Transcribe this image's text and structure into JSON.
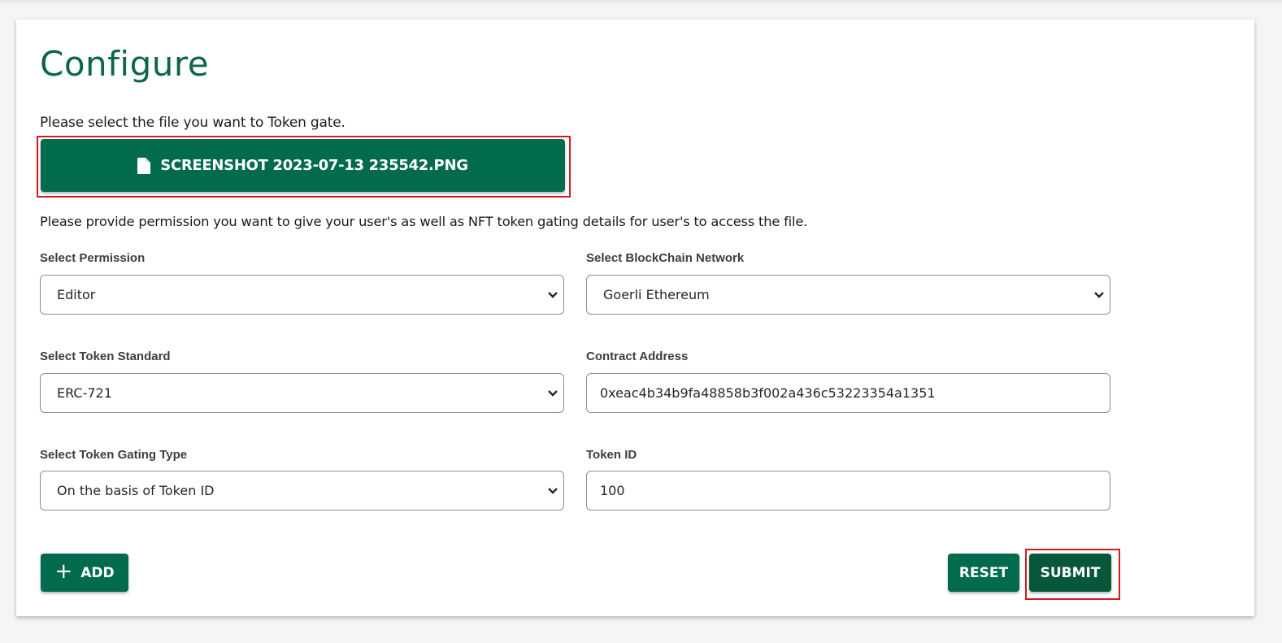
{
  "page": {
    "title": "Configure",
    "file_prompt": "Please select the file you want to Token gate.",
    "selected_file": {
      "label": "SCREENSHOT 2023-07-13 235542.PNG",
      "icon": "file-icon"
    },
    "permission_prompt": "Please provide permission you want to give your user's as well as NFT token gating details for user's to access the file."
  },
  "form": {
    "permission": {
      "label": "Select Permission",
      "value": "Editor"
    },
    "network": {
      "label": "Select BlockChain Network",
      "value": "Goerli Ethereum"
    },
    "token_standard": {
      "label": "Select Token Standard",
      "value": "ERC-721"
    },
    "contract_address": {
      "label": "Contract Address",
      "value": "0xeac4b34b9fa48858b3f002a436c53223354a1351"
    },
    "gating_type": {
      "label": "Select Token Gating Type",
      "value": "On the basis of Token ID"
    },
    "token_id": {
      "label": "Token ID",
      "value": "100"
    }
  },
  "actions": {
    "add_label": "ADD",
    "add_icon": "+",
    "reset_label": "RESET",
    "submit_label": "SUBMIT"
  },
  "colors": {
    "primary": "#026b4d",
    "submit": "#07583a",
    "title": "#0e6648",
    "highlight": "#d6191f"
  }
}
